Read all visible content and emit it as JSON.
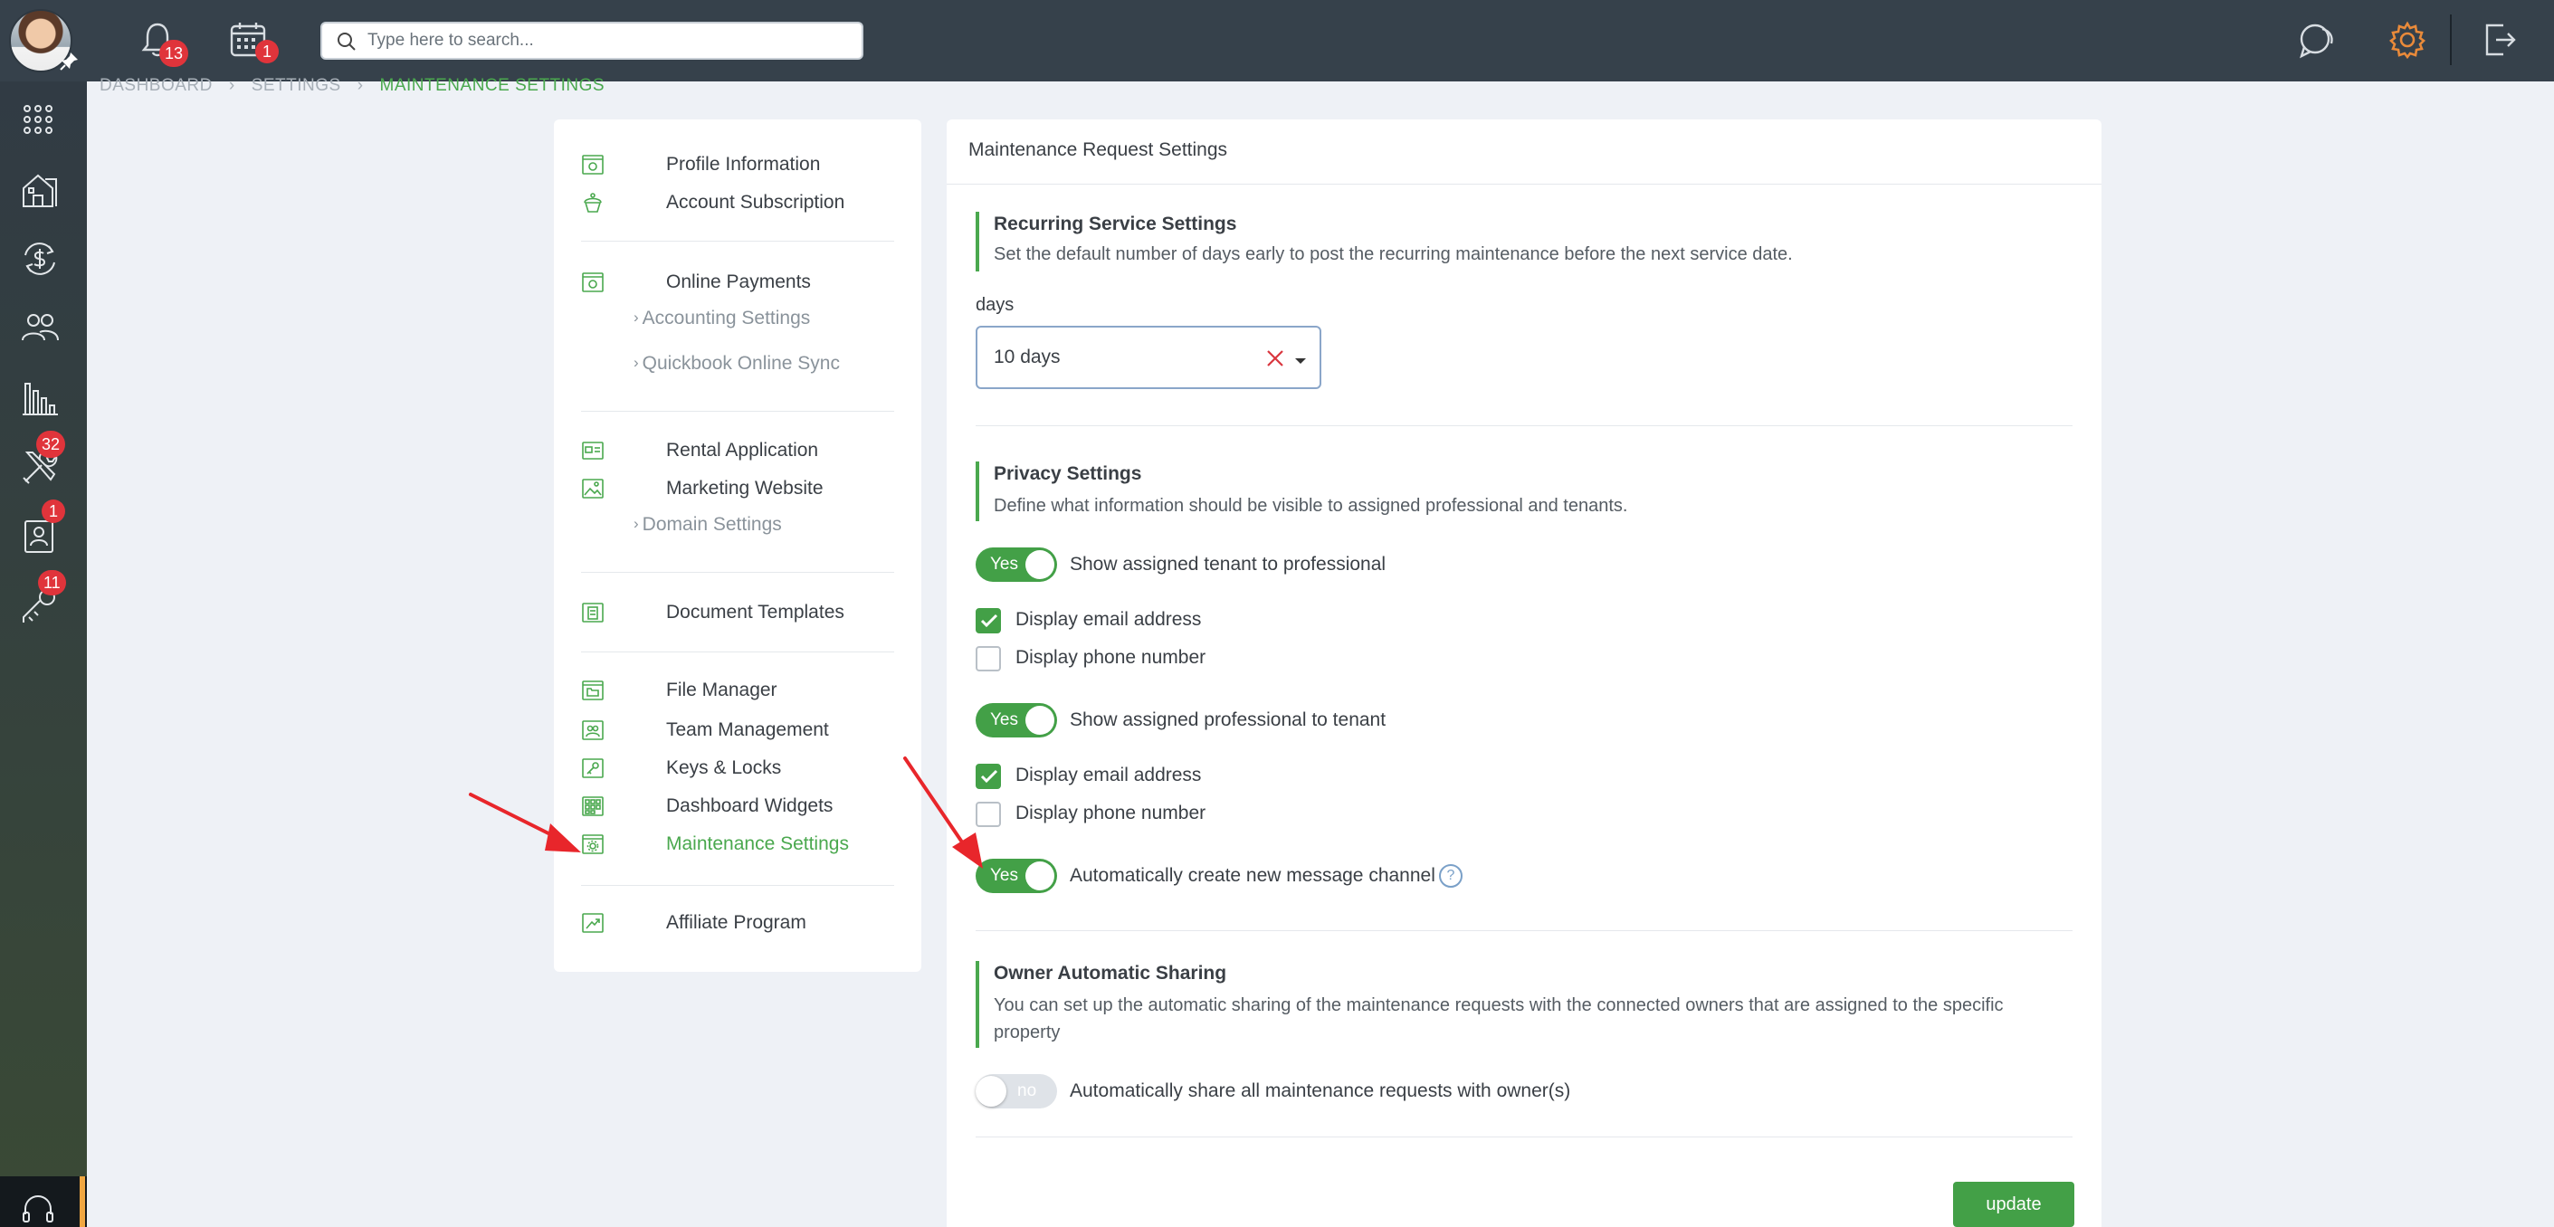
{
  "topbar": {
    "notifications_count": "13",
    "calendar_count": "1",
    "search_placeholder": "Type here to search..."
  },
  "rail": {
    "maintenance_count": "32",
    "applicants_count": "1",
    "keys_count": "11"
  },
  "breadcrumb": {
    "items": [
      "DASHBOARD",
      "SETTINGS",
      "MAINTENANCE SETTINGS"
    ]
  },
  "nav": {
    "profile_information": "Profile Information",
    "account_subscription": "Account Subscription",
    "online_payments": "Online Payments",
    "accounting_settings": "Accounting Settings",
    "quickbook_online_sync": "Quickbook Online Sync",
    "rental_application": "Rental Application",
    "marketing_website": "Marketing Website",
    "domain_settings": "Domain Settings",
    "document_templates": "Document Templates",
    "file_manager": "File Manager",
    "team_management": "Team Management",
    "keys_locks": "Keys & Locks",
    "dashboard_widgets": "Dashboard Widgets",
    "maintenance_settings": "Maintenance Settings",
    "affiliate_program": "Affiliate Program"
  },
  "main": {
    "title": "Maintenance Request Settings",
    "recurring": {
      "title": "Recurring Service Settings",
      "description": "Set the default number of days early to post the recurring maintenance before the next service date.",
      "days_label": "days",
      "days_value": "10 days"
    },
    "privacy": {
      "title": "Privacy Settings",
      "description": "Define what information should be visible to assigned professional and tenants.",
      "show_tenant_toggle": "Yes",
      "show_tenant_label": "Show assigned tenant to professional",
      "tenant_email_label": "Display email address",
      "tenant_phone_label": "Display phone number",
      "show_pro_toggle": "Yes",
      "show_pro_label": "Show assigned professional to tenant",
      "pro_email_label": "Display email address",
      "pro_phone_label": "Display phone number",
      "auto_channel_toggle": "Yes",
      "auto_channel_label": "Automatically create new message channel",
      "help_glyph": "?"
    },
    "owner_sharing": {
      "title": "Owner Automatic Sharing",
      "description": "You can set up the automatic sharing of the maintenance requests with the connected owners that are assigned to the specific property",
      "toggle_text": "no",
      "toggle_label": "Automatically share all maintenance requests with owner(s)"
    },
    "update_label": "update"
  },
  "colors": {
    "accent": "#43a047",
    "topbar": "#36414b",
    "badge": "#e0343b",
    "annotation_arrow": "#e8262b"
  }
}
